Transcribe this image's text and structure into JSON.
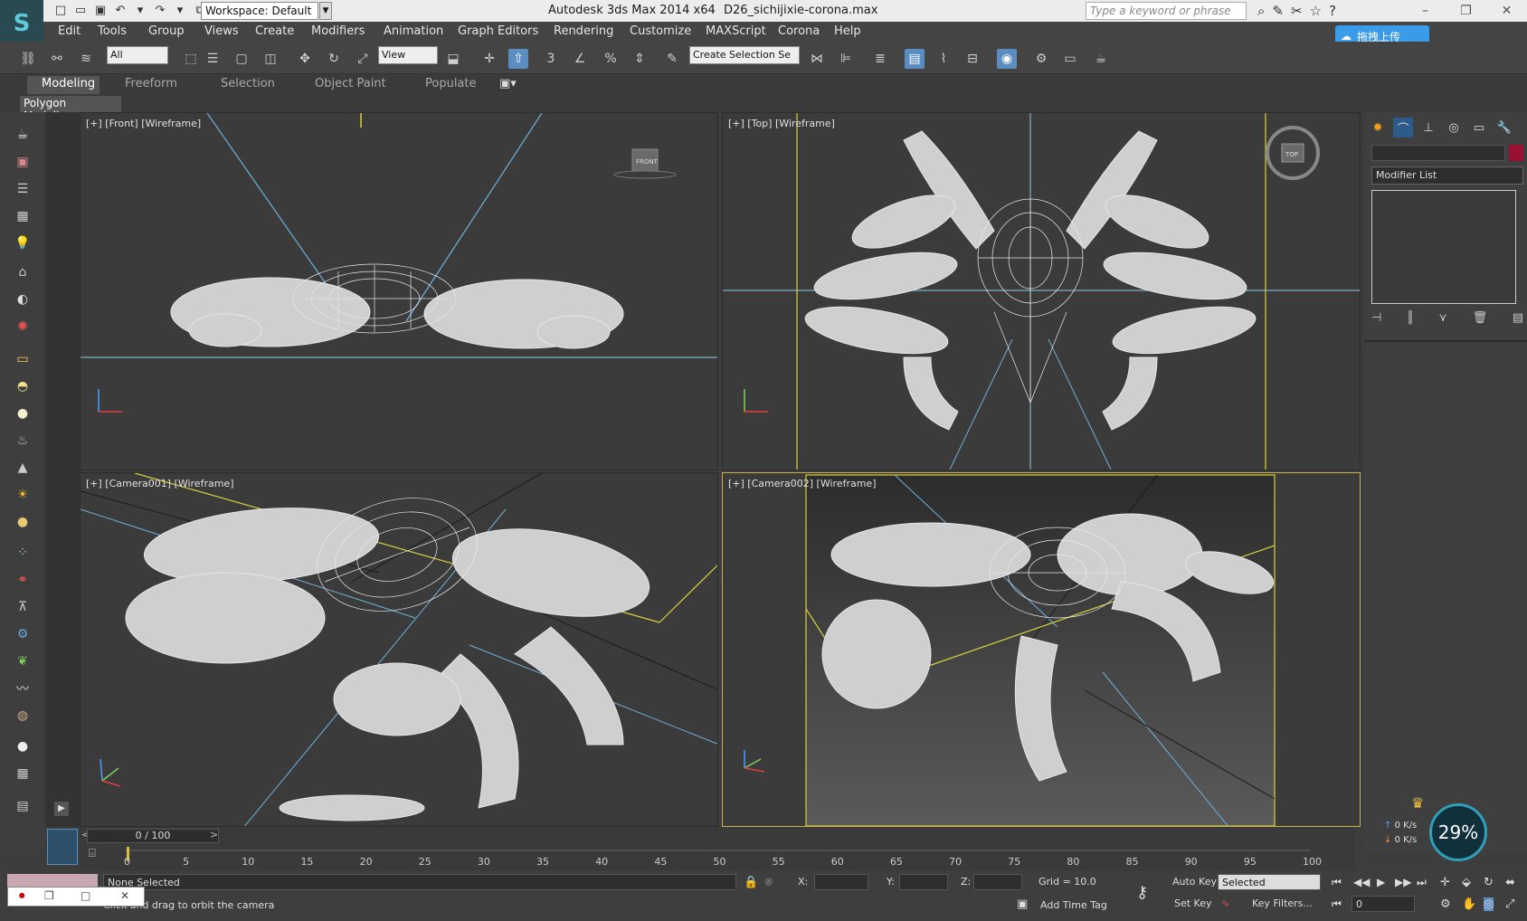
{
  "titlebar": {
    "workspace": "Workspace: Default",
    "app_title": "Autodesk 3ds Max  2014 x64",
    "file_name": "D26_sichijixie-corona.max",
    "search_placeholder": "Type a keyword or phrase"
  },
  "menu": [
    "Edit",
    "Tools",
    "Group",
    "Views",
    "Create",
    "Modifiers",
    "Animation",
    "Graph Editors",
    "Rendering",
    "Customize",
    "MAXScript",
    "Corona",
    "Help"
  ],
  "upload_button": "拖拽上传",
  "toolbar": {
    "selection_filter": "All",
    "ref_coord": "View",
    "named_selection": "Create Selection Se"
  },
  "ribbon": {
    "tabs": [
      "Modeling",
      "Freeform",
      "Selection",
      "Object Paint",
      "Populate"
    ],
    "active_tab": "Modeling",
    "panel": "Polygon Modeling"
  },
  "viewports": {
    "front": "[+] [Front] [Wireframe]",
    "top": "[+] [Top] [Wireframe]",
    "camera1": "[+] [Camera001] [Wireframe]",
    "camera2": "[+] [Camera002] [Wireframe]",
    "front_cube": "FRONT",
    "top_cube": "TOP"
  },
  "command_panel": {
    "modifier_list": "Modifier List"
  },
  "timeline": {
    "frame": "0 / 100",
    "ticks": [
      "0",
      "5",
      "10",
      "15",
      "20",
      "25",
      "30",
      "35",
      "40",
      "45",
      "50",
      "55",
      "60",
      "65",
      "70",
      "75",
      "80",
      "85",
      "90",
      "95",
      "100"
    ]
  },
  "status": {
    "selection": "None Selected",
    "prompt": "Click and drag to orbit the camera",
    "x_label": "X:",
    "y_label": "Y:",
    "z_label": "Z:",
    "grid": "Grid = 10.0",
    "add_time_tag": "Add Time Tag",
    "auto_key": "Auto Key",
    "set_key": "Set Key",
    "key_mode": "Selected",
    "key_filters": "Key Filters...",
    "frame_field": "0"
  },
  "overlay": {
    "net_up": "0 K/s",
    "net_down": "0 K/s",
    "gauge": "29%"
  }
}
